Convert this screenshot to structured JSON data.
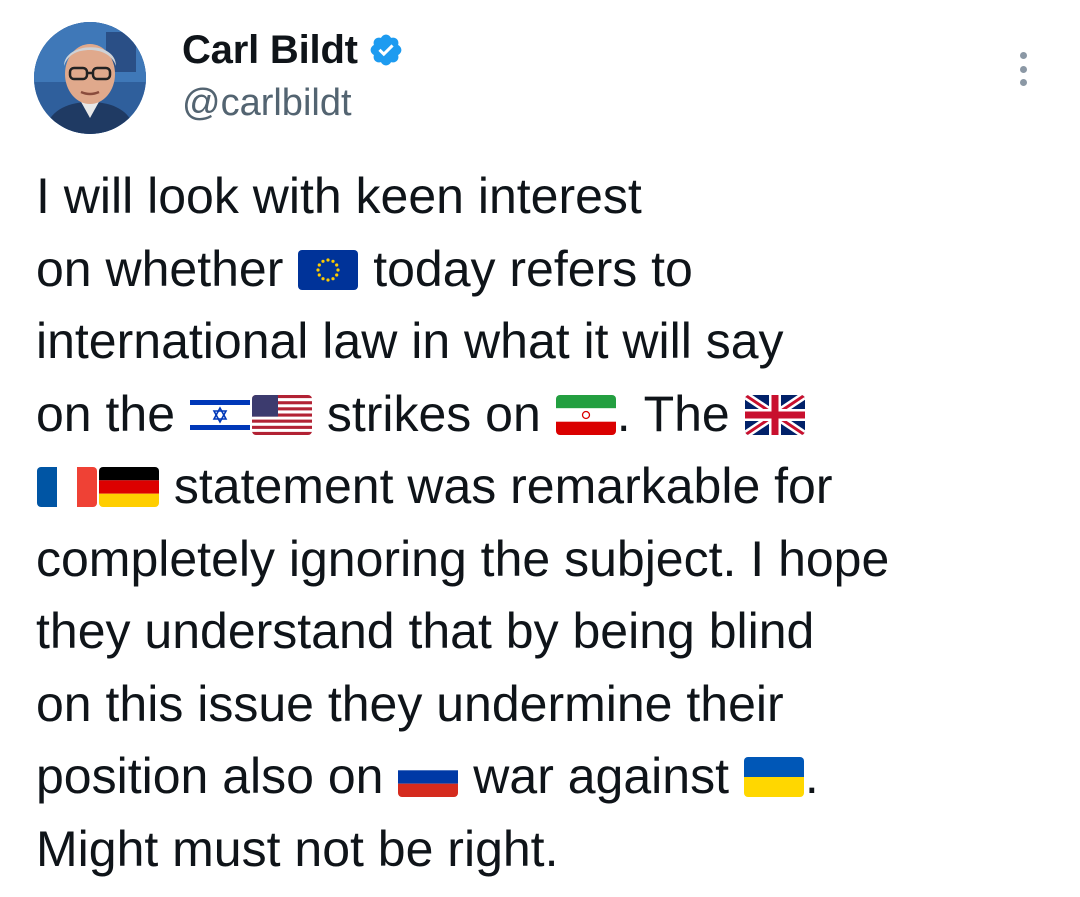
{
  "author": {
    "display_name": "Carl Bildt",
    "handle": "@carlbildt",
    "verified": true,
    "verified_color": "#1d9bf0"
  },
  "tweet": {
    "segments": {
      "l1": "I will look with keen interest",
      "l2a": "on whether",
      "l2b": "today refers to",
      "l3": "international law in what it will say",
      "l4a": "on the",
      "l4b": "strikes on",
      "l4c": ". The",
      "l5": "statement was remarkable for",
      "l6": "completely ignoring the subject. I hope",
      "l7": "they understand that by being blind",
      "l8": "on this issue they undermine their",
      "l9a": "position also on",
      "l9b": "war against",
      "l9c": ".",
      "l10": "Might must not be right."
    },
    "flags": [
      "eu-flag-icon",
      "israel-flag-icon",
      "usa-flag-icon",
      "iran-flag-icon",
      "uk-flag-icon",
      "france-flag-icon",
      "germany-flag-icon",
      "russia-flag-icon",
      "ukraine-flag-icon"
    ]
  },
  "colors": {
    "text": "#0f1419",
    "secondary": "#536471",
    "background": "#ffffff"
  }
}
